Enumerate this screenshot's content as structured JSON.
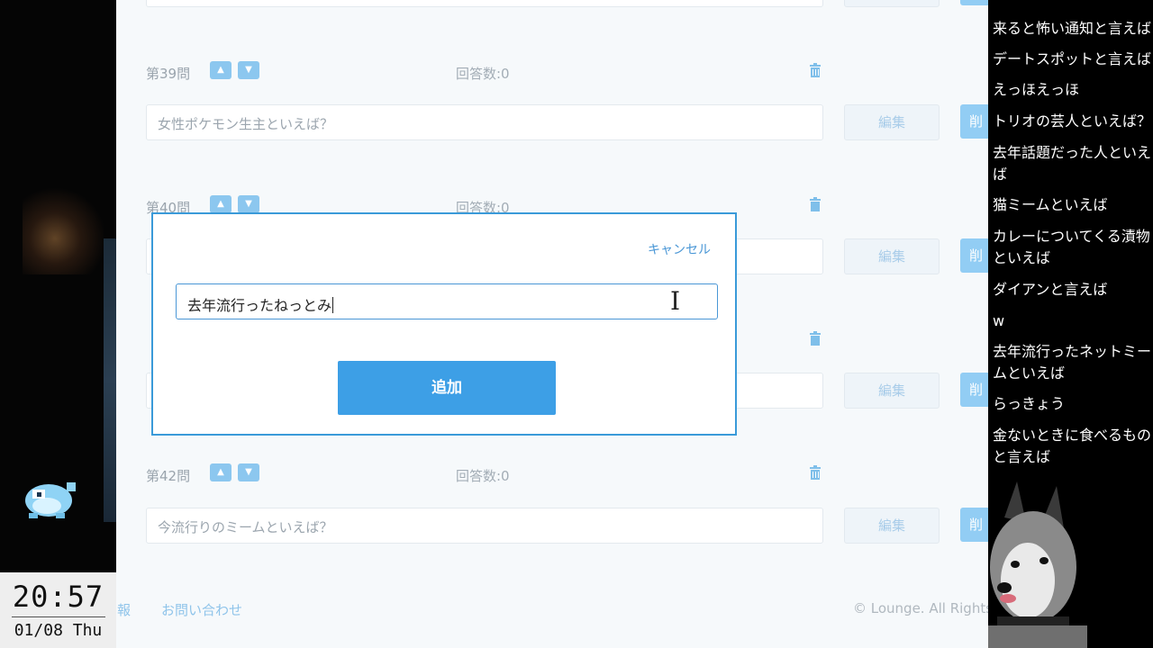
{
  "clock": {
    "time": "20:57",
    "date": "01/08 Thu"
  },
  "questions": [
    {
      "label": "第39問",
      "count": "回答数:0",
      "placeholder": "女性ポケモン生主といえば？"
    },
    {
      "label": "第40問",
      "count": "回答数:0",
      "placeholder": ""
    },
    {
      "label": "",
      "count": "",
      "placeholder": ""
    },
    {
      "label": "第42問",
      "count": "回答数:0",
      "placeholder": "今流行りのミームといえば？"
    }
  ],
  "buttons": {
    "edit": "編集",
    "side": "削"
  },
  "modal": {
    "cancel": "キャンセル",
    "input_value": "去年流行ったねっとみ",
    "add": "追加"
  },
  "footer": {
    "link_partial": "報",
    "contact": "お問い合わせ",
    "copyright": "© Lounge. All Rights"
  },
  "chat": [
    "来ると怖い通知と言えば",
    "デートスポットと言えば",
    "えっほえっほ",
    "トリオの芸人といえば？",
    "去年話題だった人といえば",
    "猫ミームといえば",
    "カレーについてくる漬物といえば",
    "ダイアンと言えば",
    "w",
    "去年流行ったネットミームといえば",
    "らっきょう",
    "金ないときに食べるものと言えば"
  ]
}
